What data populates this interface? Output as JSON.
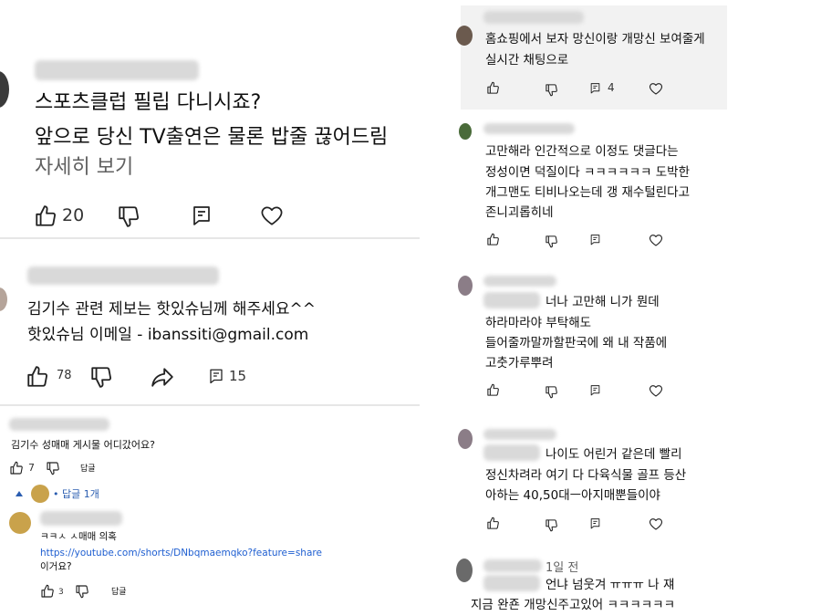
{
  "left": {
    "comment1": {
      "lines": [
        "스포츠클럽 필립 다니시죠?",
        "앞으로 당신 TV출연은 물론 밥줄 끊어드림"
      ],
      "more": "자세히 보기",
      "likes": "20"
    },
    "comment2": {
      "lines": [
        "김기수 관련 제보는 핫있슈님께 해주세요^^",
        "핫있슈님 이메일 - ibanssiti@gmail.com"
      ],
      "likes": "78",
      "replies": "15"
    },
    "comment3": {
      "text": "김기수 성매매 게시물 어디갔어요?",
      "likes": "7",
      "reply_label": "답글",
      "replies_toggle": "• 답글 1개"
    },
    "reply": {
      "line1": "ㅋㅋㅅ ㅅ매매 의혹",
      "link": "https://youtube.com/shorts/DNbqmaemqko?feature=share",
      "line3": "이거요?",
      "likes": "3",
      "reply_label": "답글"
    }
  },
  "right": {
    "c1": {
      "lines": [
        "홈쇼핑에서 보자 망신이랑 개망신 보여줄게",
        "실시간 채팅으로"
      ],
      "replies": "4"
    },
    "c2": {
      "lines": [
        "고만해라 인간적으로 이정도 댓글다는",
        "정성이면 덕질이다 ㅋㅋㅋㅋㅋㅋ 도박한",
        "개그맨도 티비나오는데 갱 재수털린다고",
        "존니괴롭히네"
      ]
    },
    "c3": {
      "lines": [
        "너나 고만해 니가 뭔데",
        "하라마라야 부탁해도",
        "들어줄까말까할판국에 왜 내 작품에",
        "고춧가루뿌려"
      ]
    },
    "c4": {
      "lines": [
        "나이도 어린거 같은데 빨리",
        "정신차려라 여기 다 다육식물 골프 등산",
        "아하는 40,50대ㅡ아지매뿐들이야"
      ]
    },
    "c5": {
      "time": "1일 전",
      "lines": [
        "언냐 넘웃겨 ㅠㅠㅠ 나 쟤",
        "지금 완죤 개망신주고있어 ㅋㅋㅋㅋㅋㅋ"
      ]
    }
  },
  "icons": [
    "like-icon",
    "dislike-icon",
    "reply-icon",
    "heart-icon",
    "share-icon"
  ],
  "colors": {
    "link": "#1f5fd1",
    "highlight_bg": "#f2f2f2",
    "divider": "#e6e6e6"
  }
}
